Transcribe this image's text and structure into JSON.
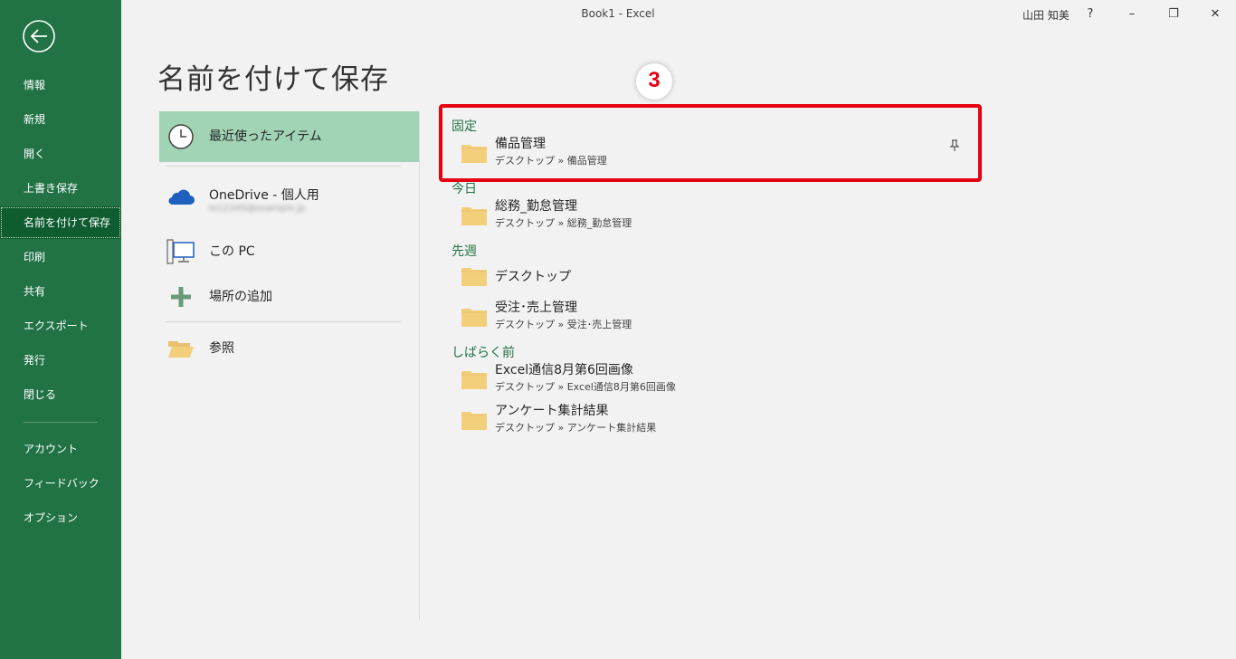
{
  "window": {
    "title": "Book1  -  Excel",
    "user": "山田 知美"
  },
  "window_controls": {
    "help": "?",
    "minimize": "–",
    "restore": "❐",
    "close": "✕"
  },
  "nav": {
    "items": [
      {
        "label": "情報"
      },
      {
        "label": "新規"
      },
      {
        "label": "開く"
      },
      {
        "label": "上書き保存"
      },
      {
        "label": "名前を付けて保存"
      },
      {
        "label": "印刷"
      },
      {
        "label": "共有"
      },
      {
        "label": "エクスポート"
      },
      {
        "label": "発行"
      },
      {
        "label": "閉じる"
      },
      {
        "label": "アカウント"
      },
      {
        "label": "フィードバック"
      },
      {
        "label": "オプション"
      }
    ],
    "active_label": "名前を付けて保存"
  },
  "page_title": "名前を付けて保存",
  "locations": [
    {
      "label": "最近使ったアイテム"
    },
    {
      "label": "OneDrive - 個人用",
      "sub": "ts12345@example.jp"
    },
    {
      "label": "この PC"
    },
    {
      "label": "場所の追加"
    },
    {
      "label": "参照"
    }
  ],
  "groups": {
    "pinned": "固定",
    "today": "今日",
    "last_week": "先週",
    "older": "しばらく前"
  },
  "folders": [
    {
      "name": "備品管理",
      "path": "デスクトップ » 備品管理"
    },
    {
      "name": "総務_勤怠管理",
      "path": "デスクトップ » 総務_勤怠管理"
    },
    {
      "name": "デスクトップ"
    },
    {
      "name": "受注･売上管理",
      "path": "デスクトップ » 受注･売上管理"
    },
    {
      "name": "Excel通信8月第6回画像",
      "path": "デスクトップ » Excel通信8月第6回画像"
    },
    {
      "name": "アンケート集計結果",
      "path": "デスクトップ » アンケート集計結果"
    }
  ],
  "annotation": {
    "step": "3"
  },
  "colors": {
    "accent": "#217346",
    "selected": "#a0d4b4",
    "highlight": "#e60012",
    "folder": "#f3cf7c"
  }
}
